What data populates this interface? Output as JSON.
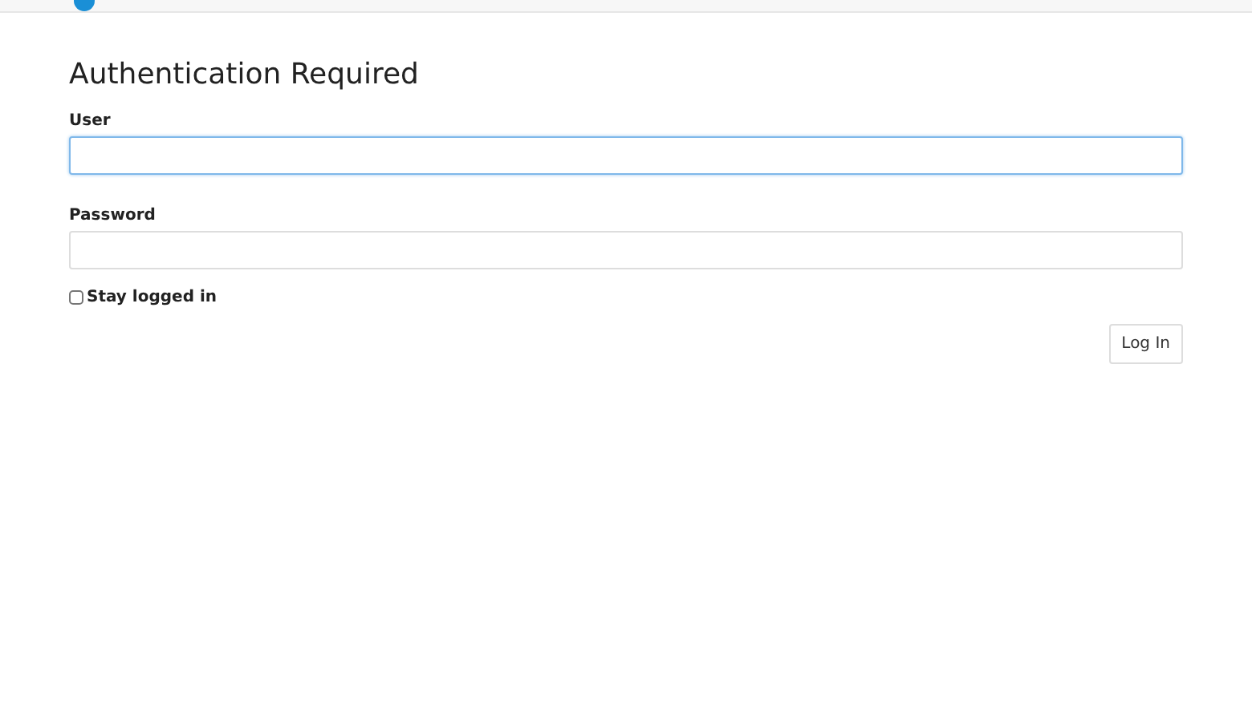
{
  "title": "Authentication Required",
  "fields": [
    {
      "label": "User",
      "focused": true
    },
    {
      "label": "Password",
      "focused": false
    }
  ],
  "stay_logged_in": {
    "label": "Stay logged in",
    "checked": false
  },
  "button": "Log In"
}
